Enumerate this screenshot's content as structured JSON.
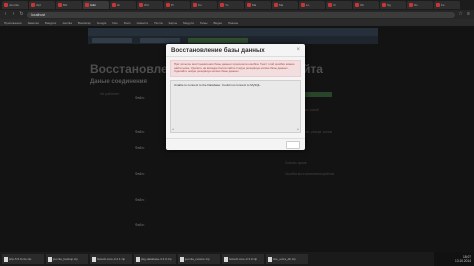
{
  "browser": {
    "tabs": [
      {
        "label": "Joomla",
        "active": false
      },
      {
        "label": "Opt",
        "active": false
      },
      {
        "label": "Bitr",
        "active": false
      },
      {
        "label": "Adm",
        "active": true
      },
      {
        "label": "Hi",
        "active": false
      },
      {
        "label": "Wd",
        "active": false
      },
      {
        "label": "Pr",
        "active": false
      },
      {
        "label": "Ko",
        "active": false
      },
      {
        "label": "Yo",
        "active": false
      },
      {
        "label": "Ma",
        "active": false
      },
      {
        "label": "Ma",
        "active": false
      },
      {
        "label": "Lo",
        "active": false
      },
      {
        "label": "Xi",
        "active": false
      },
      {
        "label": "Ok",
        "active": false
      },
      {
        "label": "Sg",
        "active": false
      },
      {
        "label": "Ns",
        "active": false
      },
      {
        "label": "Fe",
        "active": false
      }
    ],
    "url": "localhost",
    "bookmarks": [
      "Приложения",
      "Заметки",
      "Бакуриз",
      "Joomla",
      "Bootstrap",
      "Google",
      "Dev",
      "Docs",
      "Новости",
      "Почта",
      "Карты",
      "Модули",
      "Темы",
      "Видео",
      "Разное"
    ]
  },
  "page": {
    "title_left": "Восстановлени",
    "title_right": "йта",
    "section_title": "Даные соединения",
    "left_label": "Не работает",
    "file_label": "Файл:",
    "right_items": [
      "Список резервн. копий",
      "Копировать",
      "Выполнить полн. резерв. копию",
      "Удалить",
      "Скачать архив",
      "Ошибка восстановления файлов"
    ]
  },
  "modal": {
    "title": "Восстановление базы данных",
    "alert_text": "При попытке восстановления базы данных произошла ошибка. Текст этой ошибки можно найти ниже. Удалите на вкладке Копии сайта старую резервную копию базы данных. Сделайте новую резервную копию базы данных.",
    "output_text": "Unable to connect to the Database: Could not connect to MySQL.",
    "scroll_left": "◂",
    "scroll_right": "▸",
    "close": "×"
  },
  "taskbar": {
    "downloads": [
      "php-5.5.9-nts.zip",
      "joomla_backup.zip",
      "hotsoft-core-3.2.1.zip",
      "pkg-database-3.2.0.zip",
      "joomla_restore.zip",
      "hotsoft-core-3.3.0.zip",
      "site_extra_db.zip"
    ],
    "show_all": "Показать все",
    "time": "18:07",
    "date": "13.10.2014"
  }
}
